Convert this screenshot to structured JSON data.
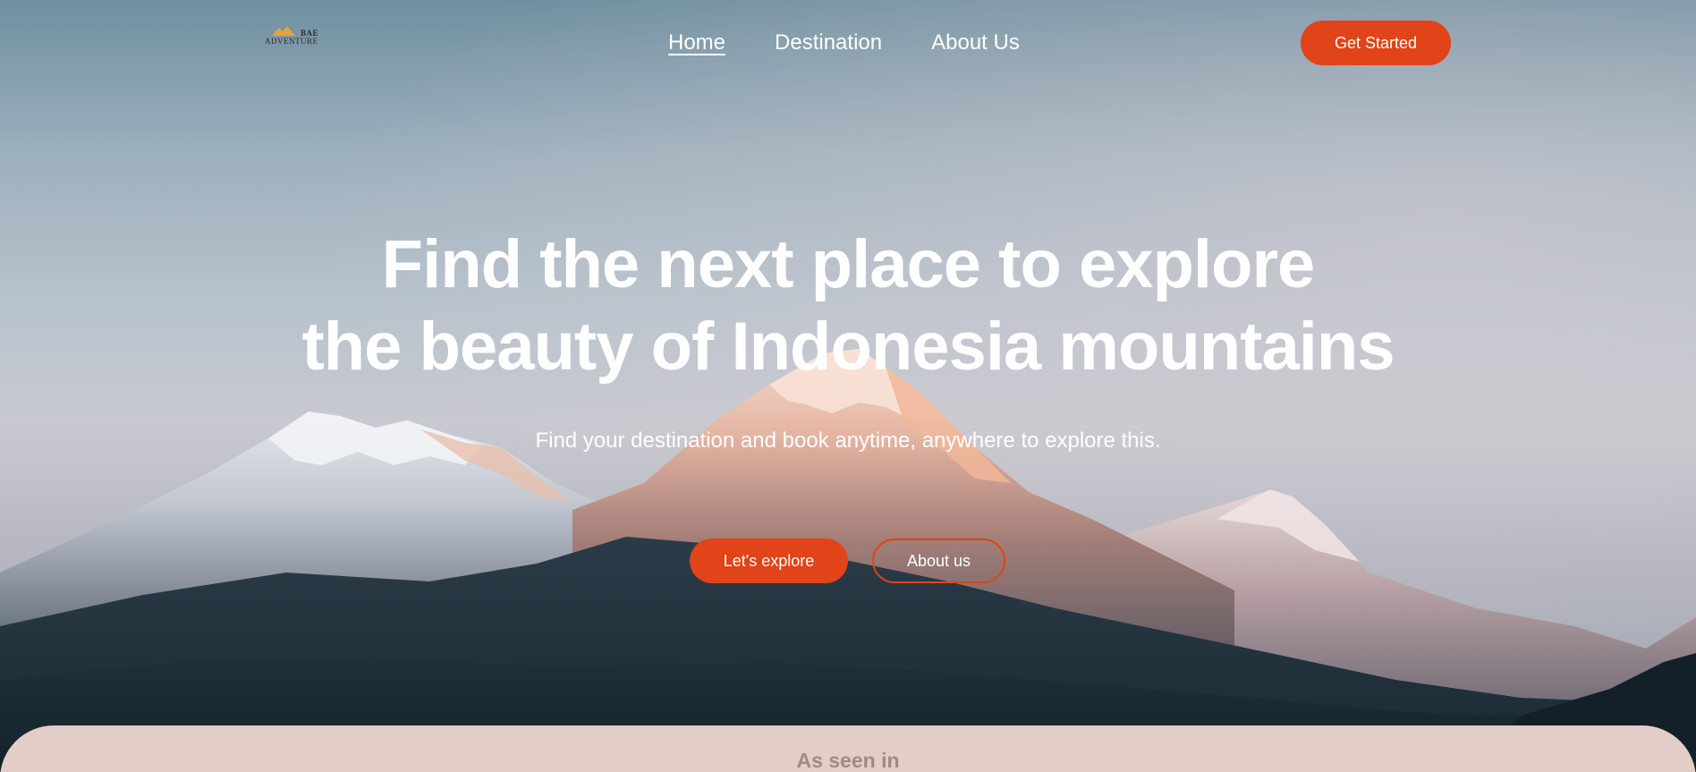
{
  "brand": {
    "logo_line1": "BAE",
    "logo_line2": "ADVENTURE",
    "logo_icon": "mountain-logo-icon"
  },
  "nav": {
    "links": [
      {
        "label": "Home",
        "active": true
      },
      {
        "label": "Destination",
        "active": false
      },
      {
        "label": "About Us",
        "active": false
      }
    ],
    "cta_label": "Get Started"
  },
  "hero": {
    "headline_line1": "Find the next place to explore",
    "headline_line2": "the beauty of Indonesia mountains",
    "subheadline": "Find your destination and book anytime, anywhere to explore this.",
    "primary_button": "Let's explore",
    "secondary_button": "About us"
  },
  "section_seen_in": {
    "title": "As seen in"
  },
  "colors": {
    "accent": "#e04418",
    "section_bg": "#e2cdc7",
    "section_text": "#a08a85",
    "text_light": "#ffffff"
  }
}
